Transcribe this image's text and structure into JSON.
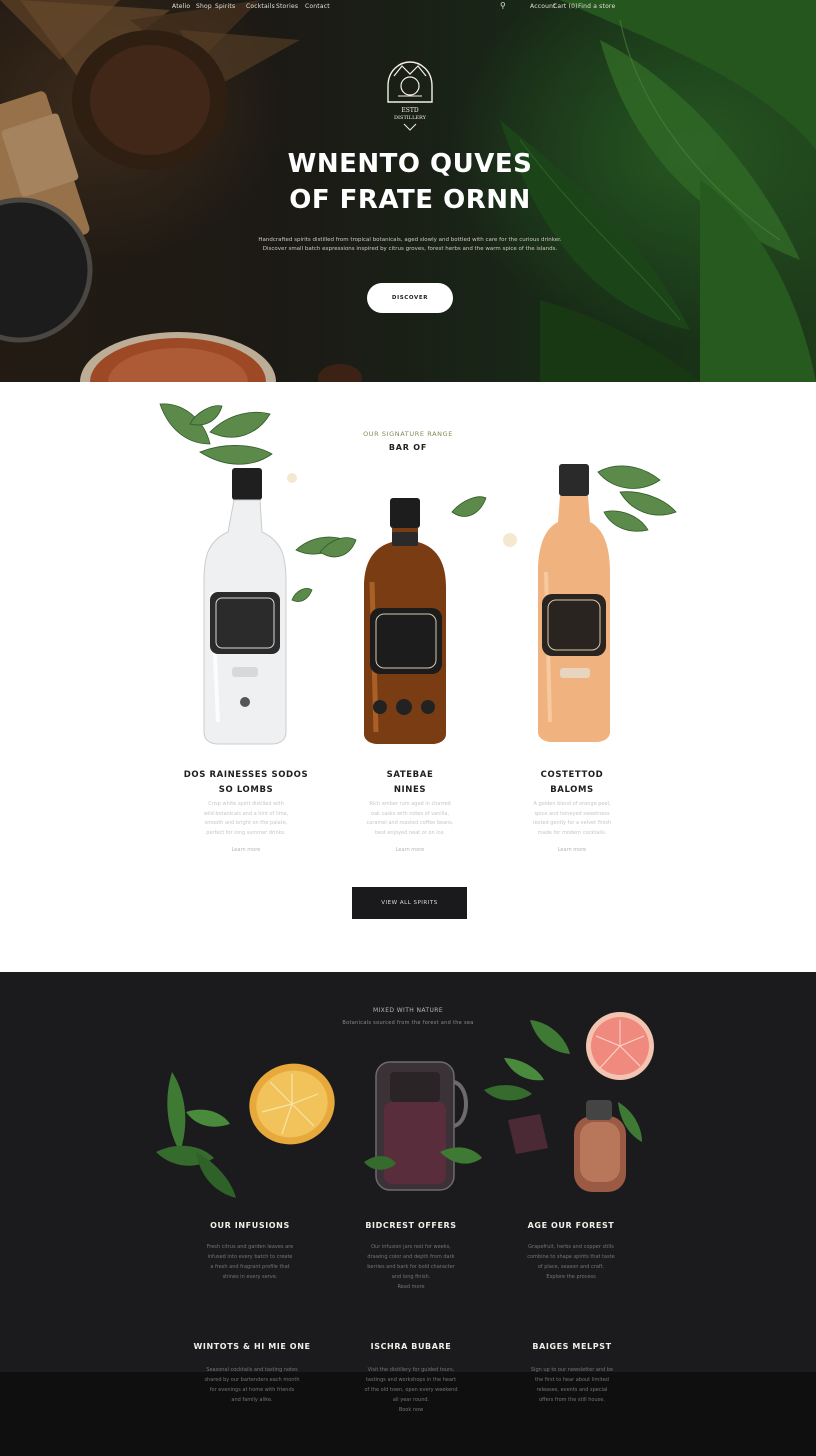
{
  "nav": {
    "left_links": [
      "Atelio",
      "Shop",
      "Spirits",
      "Cocktails",
      "Stories",
      "Contact"
    ],
    "right_links": [
      "Search",
      "Account",
      "Cart (0)",
      "Find a store"
    ]
  },
  "hero": {
    "logo_text": [
      "ESTD",
      "DISTILLERY"
    ],
    "title_line1": "WNENTO QUVES",
    "title_line2": "OF FRATE ORNN",
    "subtitle_line1": "Handcrafted spirits distilled from tropical botanicals, aged slowly and bottled with care for the curious drinker.",
    "subtitle_line2": "Discover small batch expressions inspired by citrus groves, forest herbs and the warm spice of the islands.",
    "cta_label": "DISCOVER"
  },
  "products": {
    "eyebrow": "OUR SIGNATURE RANGE",
    "title": "BAR OF",
    "items": [
      {
        "name_line1": "DOS RAINESSES SODOS",
        "name_line2": "SO LOMBS",
        "desc": [
          "Crisp white spirit distilled with",
          "wild botanicals and a hint of lime,",
          "smooth and bright on the palate,",
          "perfect for long summer drinks."
        ],
        "link": "Learn more"
      },
      {
        "name_line1": "SATEBAE",
        "name_line2": "NINES",
        "desc": [
          "Rich amber rum aged in charred",
          "oak casks with notes of vanilla,",
          "caramel and roasted coffee beans,",
          "best enjoyed neat or on ice."
        ],
        "link": "Learn more"
      },
      {
        "name_line1": "COSTETTOD",
        "name_line2": "BALOMS",
        "desc": [
          "A golden blend of orange peel,",
          "spice and honeyed sweetness",
          "rested gently for a velvet finish",
          "made for modern cocktails."
        ],
        "link": "Learn more"
      }
    ],
    "cta_label": "VIEW ALL SPIRITS"
  },
  "features": {
    "eyebrow": "MIXED WITH NATURE",
    "subtitle": "Botanicals sourced from the forest and the sea",
    "items": [
      {
        "title": "OUR INFUSIONS",
        "desc": [
          "Fresh citrus and garden leaves are",
          "infused into every batch to create",
          "a fresh and fragrant profile that",
          "shines in every serve."
        ]
      },
      {
        "title": "BIDCREST OFFERS",
        "desc": [
          "Our infusion jars rest for weeks,",
          "drawing color and depth from dark",
          "berries and bark for bold character",
          "and long finish.",
          "Read more"
        ]
      },
      {
        "title": "AGE OUR FOREST",
        "desc": [
          "Grapefruit, herbs and copper stills",
          "combine to shape spirits that taste",
          "of place, season and craft.",
          "Explore the process"
        ]
      }
    ],
    "bottom": [
      {
        "title": "WINTOTS & HI MIE ONE",
        "desc": [
          "Seasonal cocktails and tasting notes",
          "shared by our bartenders each month",
          "for evenings at home with friends",
          "and family alike."
        ]
      },
      {
        "title": "ISCHRA BUBARE",
        "desc": [
          "Visit the distillery for guided tours,",
          "tastings and workshops in the heart",
          "of the old town, open every weekend",
          "all year round.",
          "Book now"
        ]
      },
      {
        "title": "BAIGES MELPST",
        "desc": [
          "Sign up to our newsletter and be",
          "the first to hear about limited",
          "releases, events and special",
          "offers from the still house."
        ]
      }
    ]
  },
  "colors": {
    "hero_dark": "#23201a",
    "leaf_green": "#2f6a2a",
    "eyebrow_green": "#7f8f54",
    "dark_bg": "#1b1b1e",
    "amber": "#b4622a",
    "peach": "#f0b27e"
  }
}
